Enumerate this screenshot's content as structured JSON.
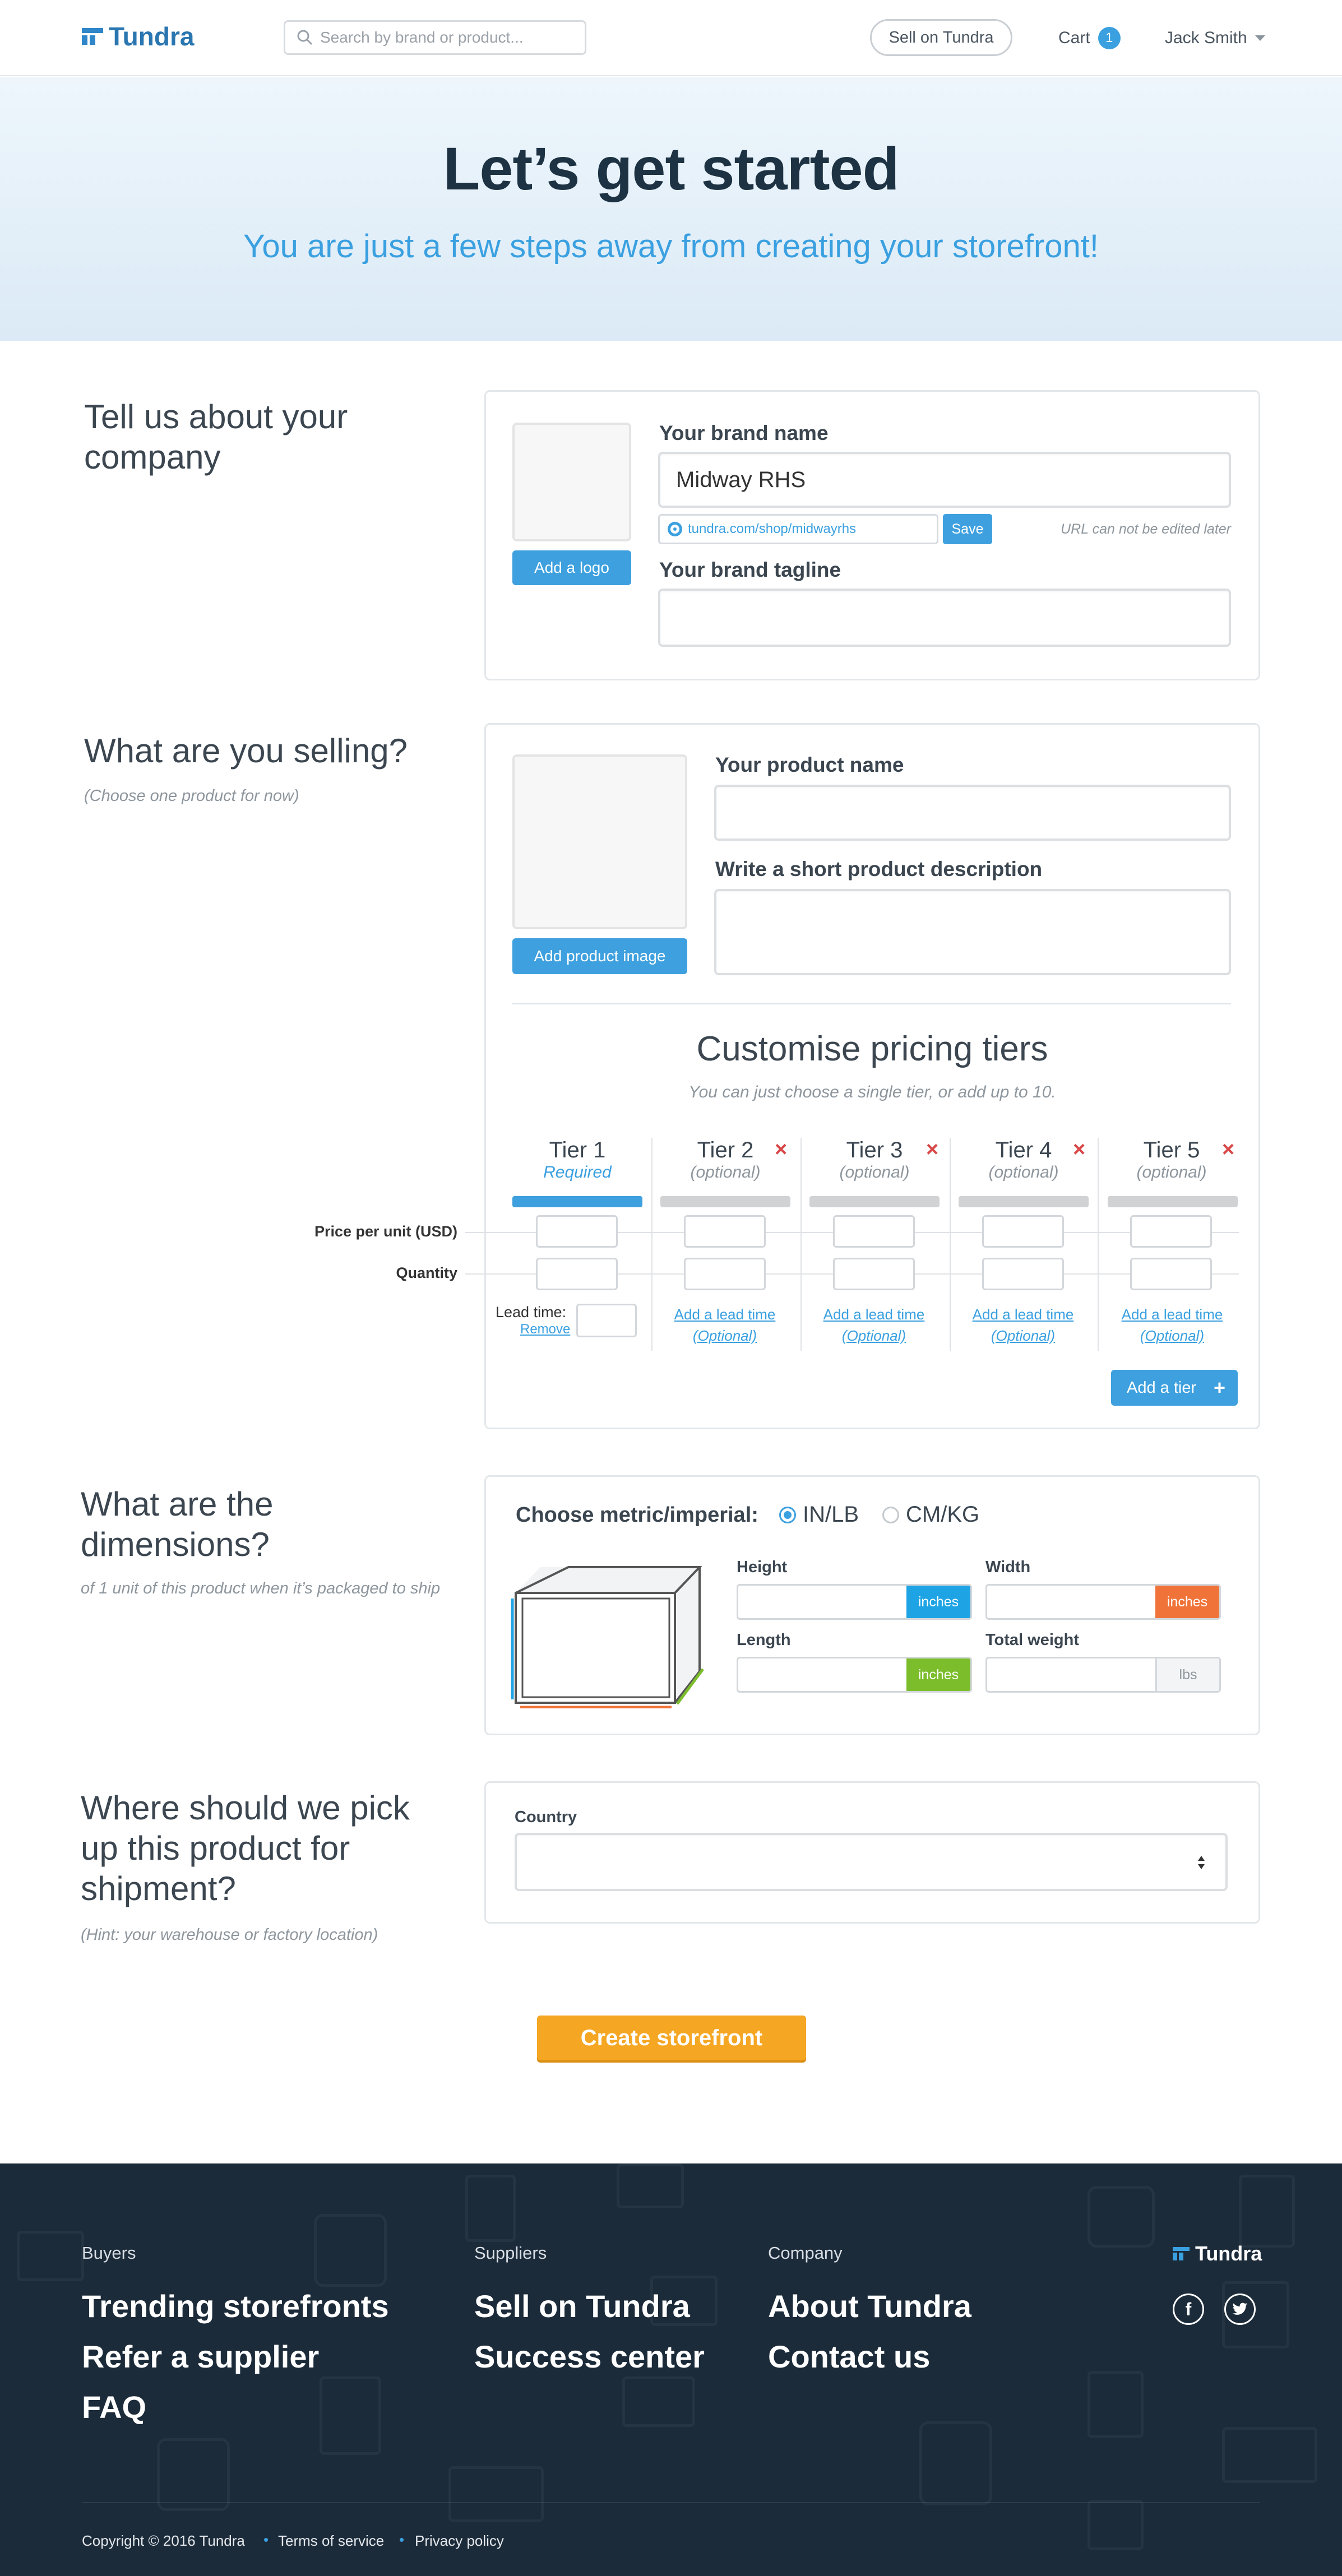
{
  "header": {
    "brand": "Tundra",
    "search_placeholder": "Search by brand or product...",
    "sell_button": "Sell on Tundra",
    "cart_label": "Cart",
    "cart_count": "1",
    "user_name": "Jack Smith"
  },
  "hero": {
    "title": "Let’s get started",
    "subtitle": "You are just a few steps away from creating your storefront!"
  },
  "company": {
    "title": "Tell us about your company",
    "add_logo": "Add a logo",
    "brand_name_label": "Your brand name",
    "brand_name_value": "Midway RHS",
    "url_value": "tundra.com/shop/midwayrhs",
    "url_save": "Save",
    "url_note": "URL can not be edited later",
    "tagline_label": "Your brand tagline"
  },
  "product": {
    "title": "What are you selling?",
    "hint": "(Choose one product for now)",
    "add_image": "Add product image",
    "name_label": "Your product name",
    "desc_label": "Write a short product description",
    "pricing_title": "Customise pricing tiers",
    "pricing_hint": "You can just choose a single tier, or add up to 10.",
    "price_row_label": "Price per unit (USD)",
    "quantity_row_label": "Quantity",
    "lead_time_label": "Lead time:",
    "remove_label": "Remove",
    "add_lead_time": "Add a lead time",
    "optional_link": "(Optional)",
    "add_tier": "Add a tier",
    "tiers": [
      {
        "name": "Tier 1",
        "status": "Required"
      },
      {
        "name": "Tier 2",
        "status": "(optional)"
      },
      {
        "name": "Tier 3",
        "status": "(optional)"
      },
      {
        "name": "Tier 4",
        "status": "(optional)"
      },
      {
        "name": "Tier 5",
        "status": "(optional)"
      }
    ]
  },
  "dimensions": {
    "title": "What are the dimensions?",
    "hint": "of 1 unit of this product when it’s packaged to ship",
    "choose_label": "Choose metric/imperial:",
    "option_imperial": "IN/LB",
    "option_metric": "CM/KG",
    "height_label": "Height",
    "width_label": "Width",
    "length_label": "Length",
    "weight_label": "Total weight",
    "unit_inches": "inches",
    "unit_lbs": "lbs",
    "colors": {
      "height": "#1ea4e4",
      "width": "#f0743a",
      "length": "#7cbd2c"
    }
  },
  "pickup": {
    "title": "Where should we pick up this product for shipment?",
    "hint": "(Hint: your warehouse or factory location)",
    "country_label": "Country"
  },
  "cta": {
    "label": "Create storefront",
    "color": "#f5a623"
  },
  "footer": {
    "buyers_head": "Buyers",
    "buyers_links": [
      "Trending  storefronts",
      "Refer a supplier",
      "FAQ"
    ],
    "suppliers_head": "Suppliers",
    "suppliers_links": [
      "Sell on Tundra",
      "Success center"
    ],
    "company_head": "Company",
    "company_links": [
      "About Tundra",
      "Contact us"
    ],
    "brand": "Tundra",
    "copyright": "Copyright © 2016 Tundra",
    "terms": "Terms of service",
    "privacy": "Privacy policy"
  }
}
